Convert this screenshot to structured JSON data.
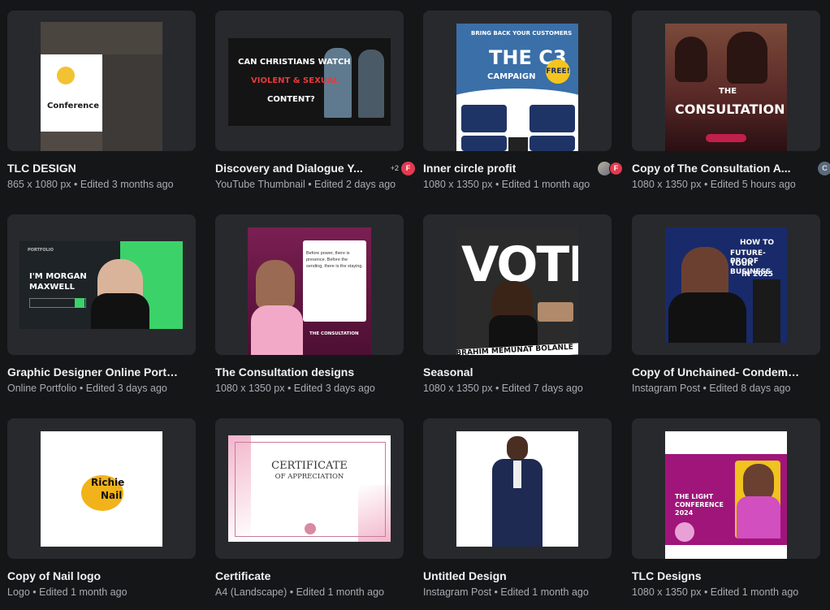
{
  "designs": [
    {
      "title": "TLC DESIGN",
      "meta": "865 x 1080 px • Edited 3 months ago",
      "thumb_text": "Conference"
    },
    {
      "title": "Discovery and Dialogue Y...",
      "meta": "YouTube Thumbnail • Edited 2 days ago",
      "collab_count": "+2",
      "avatar": "F",
      "thumb_lines": [
        "CAN CHRISTIANS WATCH",
        "VIOLENT & SEXUAL",
        "CONTENT?"
      ]
    },
    {
      "title": "Inner circle profit",
      "meta": "1080 x 1350 px • Edited 1 month ago",
      "avatar": "F",
      "thumb_lines": [
        "BRING BACK YOUR CUSTOMERS",
        "THE C3",
        "CAMPAIGN",
        "FREE!"
      ]
    },
    {
      "title": "Copy of The Consultation A...",
      "meta": "1080 x 1350 px • Edited 5 hours ago",
      "avatar": "C",
      "thumb_lines": [
        "THE",
        "CONSULTATION"
      ]
    },
    {
      "title": "Graphic Designer Online Portfo...",
      "meta": "Online Portfolio • Edited 3 days ago",
      "thumb_lines": [
        "I'M MORGAN",
        "MAXWELL",
        "PORTFOLIO"
      ]
    },
    {
      "title": "The Consultation designs",
      "meta": "1080 x 1350 px • Edited 3 days ago",
      "thumb_lines": [
        "Before power, there is presence. Before the sending, there is the staying.",
        "THE CONSULTATION"
      ]
    },
    {
      "title": "Seasonal",
      "meta": "1080 x 1350 px • Edited 7 days ago",
      "thumb_lines": [
        "VOTE",
        "IBRAHIM MEMUNAT BOLANLE"
      ]
    },
    {
      "title": "Copy of Unchained- Condemn...",
      "meta": "Instagram Post • Edited 8 days ago",
      "thumb_lines": [
        "HOW TO",
        "FUTURE-PROOF",
        "YOUR BUSINESS",
        "IN 2025"
      ]
    },
    {
      "title": "Copy of Nail logo",
      "meta": "Logo • Edited 1 month ago",
      "thumb_lines": [
        "Richie",
        "Nail"
      ]
    },
    {
      "title": "Certificate",
      "meta": "A4 (Landscape) • Edited 1 month ago",
      "thumb_lines": [
        "CERTIFICATE",
        "OF APPRECIATION"
      ]
    },
    {
      "title": "Untitled Design",
      "meta": "Instagram Post • Edited 1 month ago"
    },
    {
      "title": "TLC Designs",
      "meta": "1080 x 1350 px • Edited 1 month ago",
      "thumb_lines": [
        "THE LIGHT",
        "CONFERENCE",
        "2024"
      ]
    }
  ],
  "colors": {
    "background": "#151618",
    "card": "#28292d",
    "avatar_f": "#e53950"
  }
}
